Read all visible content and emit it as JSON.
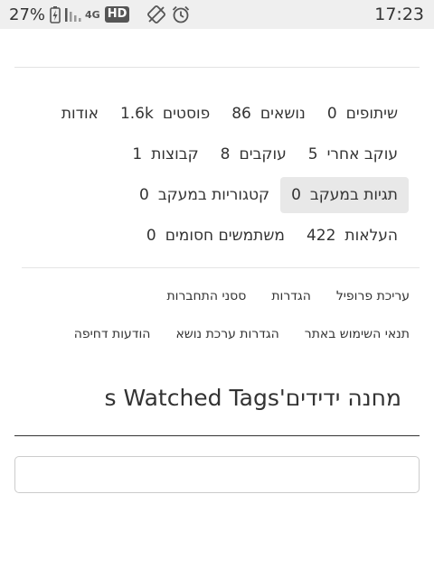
{
  "status_bar": {
    "battery_percent": "27%",
    "network": "4G",
    "hd_badge": "HD",
    "time": "17:23"
  },
  "profile_stats": {
    "row1": [
      {
        "label": "אודות",
        "value": ""
      },
      {
        "label": "פוסטים",
        "value": "1.6k"
      },
      {
        "label": "נושאים",
        "value": "86"
      },
      {
        "label": "שיתופים",
        "value": "0"
      }
    ],
    "row2": [
      {
        "label": "קבוצות",
        "value": "1"
      },
      {
        "label": "עוקבים",
        "value": "8"
      },
      {
        "label": "עוקב אחרי",
        "value": "5"
      }
    ],
    "row3": [
      {
        "label": "קטגוריות במעקב",
        "value": "0"
      },
      {
        "label": "תגיות במעקב",
        "value": "0",
        "active": true
      }
    ],
    "row4": [
      {
        "label": "משתמשים חסומים",
        "value": "0"
      },
      {
        "label": "העלאות",
        "value": "422"
      }
    ]
  },
  "settings_links": {
    "row1": [
      "עריכת פרופיל",
      "הגדרות",
      "ססני התחברות"
    ],
    "row2": [
      "תנאי השימוש באתר",
      "הגדרות ערכת נושא",
      "הודעות דחיפה"
    ]
  },
  "page": {
    "title": "מחנה ידידים's Watched Tags",
    "search_value": ""
  }
}
